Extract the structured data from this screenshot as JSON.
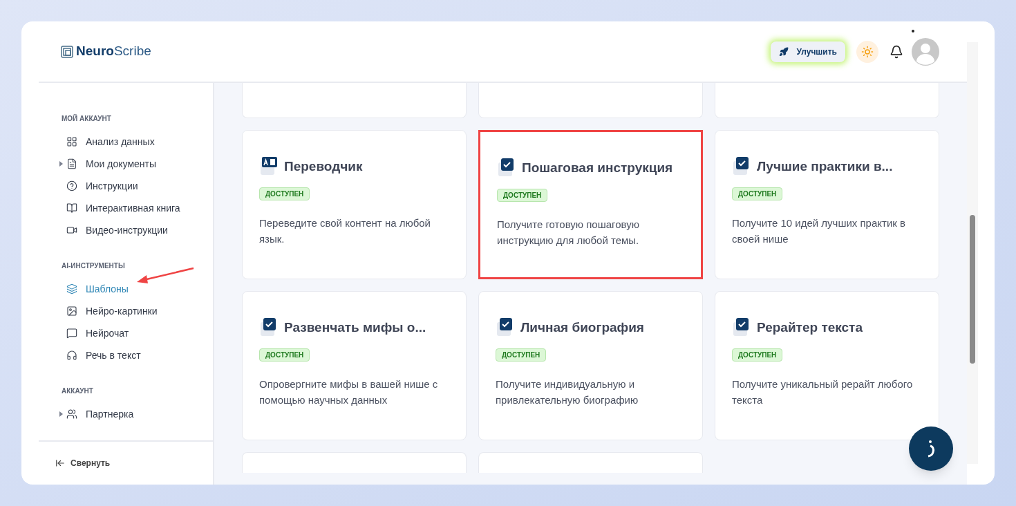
{
  "logo": {
    "bold": "Neuro",
    "rest": "Scribe"
  },
  "header": {
    "upgrade_button": "Улучшить"
  },
  "sidebar": {
    "sections": [
      {
        "heading": "МОЙ АККАУНТ",
        "items": [
          {
            "label": "Анализ данных",
            "selected": false,
            "has_children": false
          },
          {
            "label": "Мои документы",
            "selected": false,
            "has_children": true
          },
          {
            "label": "Инструкции",
            "selected": false,
            "has_children": false
          },
          {
            "label": "Интерактивная книга",
            "selected": false,
            "has_children": false
          },
          {
            "label": "Видео-инструкции",
            "selected": false,
            "has_children": false
          }
        ]
      },
      {
        "heading": "AI-ИНСТРУМЕНТЫ",
        "items": [
          {
            "label": "Шаблоны",
            "selected": true,
            "has_children": false
          },
          {
            "label": "Нейро-картинки",
            "selected": false,
            "has_children": false
          },
          {
            "label": "Нейрочат",
            "selected": false,
            "has_children": false
          },
          {
            "label": "Речь в текст",
            "selected": false,
            "has_children": false
          }
        ]
      },
      {
        "heading": "АККАУНТ",
        "items": [
          {
            "label": "Партнерка",
            "selected": false,
            "has_children": true
          }
        ]
      }
    ],
    "collapse": "Свернуть"
  },
  "cards": [
    {
      "kind": "translate",
      "title": "Переводчик",
      "badge": "ДОСТУПЕН",
      "description": "Переведите свой контент на любой язык.",
      "highlighted": false
    },
    {
      "kind": "checklist",
      "title": "Пошаговая инструкция",
      "badge": "ДОСТУПЕН",
      "description": "Получите готовую пошаговую инструкцию для любой темы.",
      "highlighted": true
    },
    {
      "kind": "checklist",
      "title": "Лучшие практики в...",
      "badge": "ДОСТУПЕН",
      "description": "Получите 10 идей лучших практик в своей нише",
      "highlighted": false
    },
    {
      "kind": "checklist",
      "title": "Развенчать мифы о...",
      "badge": "ДОСТУПЕН",
      "description": "Опровергните мифы в вашей нише с помощью научных данных",
      "highlighted": false
    },
    {
      "kind": "checklist",
      "title": "Личная биография",
      "badge": "ДОСТУПЕН",
      "description": "Получите индивидуальную и привлекательную биографию",
      "highlighted": false
    },
    {
      "kind": "checklist",
      "title": "Рерайтер текста",
      "badge": "ДОСТУПЕН",
      "description": "Получите уникальный рерайт любого текста",
      "highlighted": false
    }
  ]
}
